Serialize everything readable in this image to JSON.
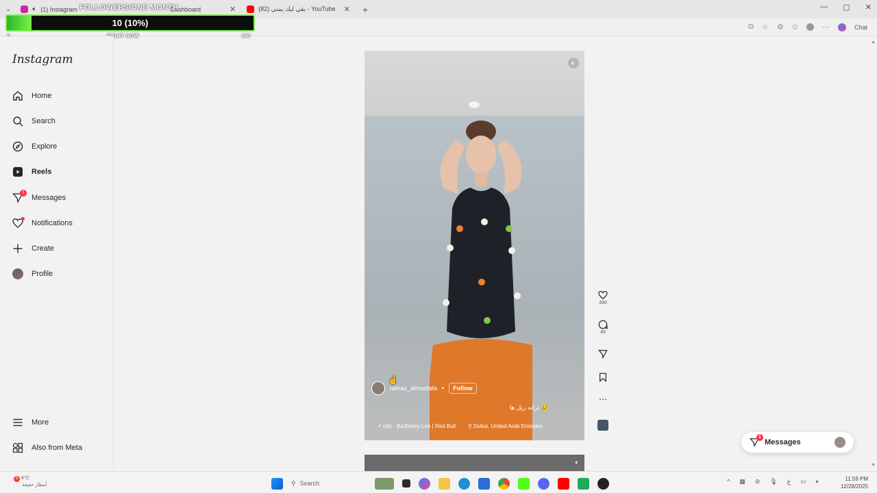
{
  "browser": {
    "tabs": [
      {
        "label": "(1) Instagram",
        "favicon_color": "#d6249f"
      },
      {
        "label": "Dashboard",
        "favicon_color": "#e0e0e0"
      },
      {
        "label": "بقي ليك يمني (82) - YouTube",
        "favicon_color": "#ff0000"
      }
    ],
    "new_tab": "+",
    "chat_label": "Chat",
    "window_controls": {
      "minimize": "—",
      "maximize": "▢",
      "close": "✕"
    }
  },
  "follower_overlay": {
    "title": "FOLLOWERS/ONE MONTH",
    "value_text": "10 (10%)",
    "progress": 0.1,
    "min": "0",
    "now_label": "RIGHT NOW",
    "max": "100"
  },
  "sidebar": {
    "logo": "Instagram",
    "items": [
      {
        "label": "Home",
        "icon": "home-icon"
      },
      {
        "label": "Search",
        "icon": "search-icon"
      },
      {
        "label": "Explore",
        "icon": "compass-icon"
      },
      {
        "label": "Reels",
        "icon": "reels-icon"
      },
      {
        "label": "Messages",
        "icon": "messages-icon",
        "badge": "1"
      },
      {
        "label": "Notifications",
        "icon": "heart-icon"
      },
      {
        "label": "Create",
        "icon": "plus-icon"
      },
      {
        "label": "Profile",
        "icon": "avatar"
      }
    ],
    "more": "More",
    "also_from_meta": "Also from Meta"
  },
  "reel": {
    "username": "ramaz_almustafa",
    "separator": "•",
    "follow_label": "Follow",
    "caption": "ترانه ريل ها 😢",
    "audio": "↗ ody · Be3teeny Leh | Red Bull",
    "location": "Dubai, United Arab Emirates",
    "likes": "390",
    "comments": "49"
  },
  "messages_pill": {
    "label": "Messages",
    "badge": "1"
  },
  "taskbar": {
    "weather_temp": "8°C",
    "weather_desc": "أمطار خفيفة",
    "weather_badge": "5",
    "search_label": "Search",
    "time": "11:59 PM",
    "date": "12/28/2025",
    "lang": "ع"
  }
}
